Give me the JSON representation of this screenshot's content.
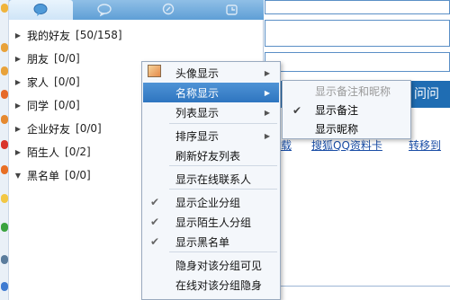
{
  "tabs": [
    {
      "icon": "chat-bubble-icon",
      "active": true
    },
    {
      "icon": "group-chat-icon",
      "active": false
    },
    {
      "icon": "zone-icon",
      "active": false
    },
    {
      "icon": "recent-contacts-icon",
      "active": false
    }
  ],
  "groups": [
    {
      "name": "我的好友",
      "count": "[50/158]",
      "expanded": false
    },
    {
      "name": "朋友",
      "count": "[0/0]",
      "expanded": false
    },
    {
      "name": "家人",
      "count": "[0/0]",
      "expanded": false
    },
    {
      "name": "同学",
      "count": "[0/0]",
      "expanded": false
    },
    {
      "name": "企业好友",
      "count": "[0/0]",
      "expanded": false
    },
    {
      "name": "陌生人",
      "count": "[0/2]",
      "expanded": false
    },
    {
      "name": "黑名单",
      "count": "[0/0]",
      "expanded": true
    }
  ],
  "right_panel": {
    "bar_text": "问问",
    "link_left": "载",
    "link_mid": "搜狐QQ资料卡",
    "link_right": "转移到"
  },
  "context_menu": {
    "items": [
      {
        "label": "头像显示",
        "submenu": true,
        "checked": false,
        "highlight": false
      },
      {
        "label": "名称显示",
        "submenu": true,
        "checked": false,
        "highlight": true
      },
      {
        "label": "列表显示",
        "submenu": true,
        "checked": false,
        "highlight": false
      },
      {
        "label": "排序显示",
        "submenu": true,
        "checked": false,
        "highlight": false
      },
      {
        "label": "刷新好友列表",
        "submenu": false,
        "checked": false,
        "highlight": false
      },
      {
        "label": "显示在线联系人",
        "submenu": false,
        "checked": false,
        "highlight": false
      },
      {
        "label": "显示企业分组",
        "submenu": false,
        "checked": true,
        "highlight": false
      },
      {
        "label": "显示陌生人分组",
        "submenu": false,
        "checked": true,
        "highlight": false
      },
      {
        "label": "显示黑名单",
        "submenu": false,
        "checked": true,
        "highlight": false
      },
      {
        "label": "隐身对该分组可见",
        "submenu": false,
        "checked": false,
        "highlight": false
      },
      {
        "label": "在线对该分组隐身",
        "submenu": false,
        "checked": false,
        "highlight": false
      }
    ]
  },
  "submenu": {
    "items": [
      {
        "label": "显示备注和昵称",
        "checked": false,
        "disabled": true
      },
      {
        "label": "显示备注",
        "checked": true,
        "disabled": false
      },
      {
        "label": "显示昵称",
        "checked": false,
        "disabled": false
      }
    ]
  },
  "colors": {
    "accent": "#2e75c0",
    "tab_bar": "#5f9fd6",
    "right_bar": "#1f6db3"
  }
}
